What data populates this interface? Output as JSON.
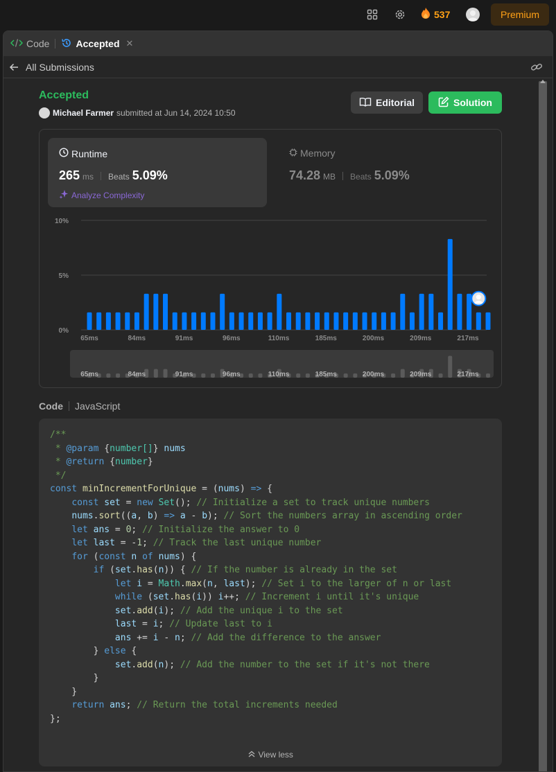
{
  "topbar": {
    "streak_count": "537",
    "premium_label": "Premium",
    "icons": [
      "layout-icon",
      "gear-icon",
      "fire-icon",
      "avatar"
    ]
  },
  "tabs": [
    {
      "label": "Code",
      "icon": "code-icon"
    },
    {
      "label": "Accepted",
      "icon": "history-icon",
      "close": "✕"
    }
  ],
  "subbar": {
    "back_label": "All Submissions"
  },
  "submission": {
    "status": "Accepted",
    "user": "Michael Farmer",
    "submitted_text": "submitted at Jun 14, 2024 10:50",
    "editorial_label": "Editorial",
    "solution_label": "Solution"
  },
  "runtime": {
    "label": "Runtime",
    "value": "265",
    "unit": "ms",
    "beats_label": "Beats",
    "beats_value": "5.09%",
    "analyze_label": "Analyze Complexity"
  },
  "memory": {
    "label": "Memory",
    "value": "74.28",
    "unit": "MB",
    "beats_label": "Beats",
    "beats_value": "5.09%"
  },
  "chart_data": {
    "type": "bar",
    "y_ticks": [
      "10%",
      "5%",
      "0%"
    ],
    "ylim": [
      0,
      10
    ],
    "x_tick_labels": [
      "65ms",
      "84ms",
      "91ms",
      "96ms",
      "110ms",
      "185ms",
      "200ms",
      "209ms",
      "217ms"
    ],
    "values": [
      1.6,
      1.6,
      1.6,
      1.6,
      1.6,
      1.6,
      3.3,
      3.3,
      3.3,
      1.6,
      1.6,
      1.6,
      1.6,
      1.6,
      3.3,
      1.6,
      1.6,
      1.6,
      1.6,
      1.6,
      3.3,
      1.6,
      1.6,
      1.6,
      1.6,
      1.6,
      1.6,
      1.6,
      1.6,
      1.6,
      1.6,
      1.6,
      1.6,
      3.3,
      1.6,
      3.3,
      3.3,
      1.6,
      8.3,
      3.3,
      3.3,
      1.6,
      1.6
    ],
    "highlight_index": 41,
    "bar_color": "#007aff",
    "grid": true
  },
  "code_section": {
    "label": "Code",
    "language": "JavaScript",
    "view_less": "View less",
    "lines": [
      [
        [
          "c",
          "/**"
        ]
      ],
      [
        [
          "c",
          " * "
        ],
        [
          "doc",
          "@param"
        ],
        [
          "c",
          " "
        ],
        [
          "p",
          "{"
        ],
        [
          "t",
          "number[]"
        ],
        [
          "p",
          "}"
        ],
        [
          "v",
          " nums"
        ]
      ],
      [
        [
          "c",
          " * "
        ],
        [
          "doc",
          "@return"
        ],
        [
          "c",
          " "
        ],
        [
          "p",
          "{"
        ],
        [
          "t",
          "number"
        ],
        [
          "p",
          "}"
        ]
      ],
      [
        [
          "c",
          " */"
        ]
      ],
      [
        [
          "k",
          "const"
        ],
        [
          "p",
          " "
        ],
        [
          "f",
          "minIncrementForUnique"
        ],
        [
          "p",
          " = ("
        ],
        [
          "v",
          "nums"
        ],
        [
          "p",
          ") "
        ],
        [
          "k",
          "=>"
        ],
        [
          "p",
          " {"
        ]
      ],
      [
        [
          "p",
          "    "
        ],
        [
          "k",
          "const"
        ],
        [
          "p",
          " "
        ],
        [
          "v",
          "set"
        ],
        [
          "p",
          " = "
        ],
        [
          "k",
          "new"
        ],
        [
          "p",
          " "
        ],
        [
          "t",
          "Set"
        ],
        [
          "p",
          "(); "
        ],
        [
          "c",
          "// Initialize a set to track unique numbers"
        ]
      ],
      [
        [
          "p",
          "    "
        ],
        [
          "v",
          "nums"
        ],
        [
          "p",
          "."
        ],
        [
          "f",
          "sort"
        ],
        [
          "p",
          "(("
        ],
        [
          "v",
          "a"
        ],
        [
          "p",
          ", "
        ],
        [
          "v",
          "b"
        ],
        [
          "p",
          ") "
        ],
        [
          "k",
          "=>"
        ],
        [
          "p",
          " "
        ],
        [
          "v",
          "a"
        ],
        [
          "p",
          " - "
        ],
        [
          "v",
          "b"
        ],
        [
          "p",
          "); "
        ],
        [
          "c",
          "// Sort the numbers array in ascending order"
        ]
      ],
      [
        [
          "p",
          "    "
        ],
        [
          "k",
          "let"
        ],
        [
          "p",
          " "
        ],
        [
          "v",
          "ans"
        ],
        [
          "p",
          " = "
        ],
        [
          "n",
          "0"
        ],
        [
          "p",
          "; "
        ],
        [
          "c",
          "// Initialize the answer to 0"
        ]
      ],
      [
        [
          "p",
          "    "
        ],
        [
          "k",
          "let"
        ],
        [
          "p",
          " "
        ],
        [
          "v",
          "last"
        ],
        [
          "p",
          " = -"
        ],
        [
          "n",
          "1"
        ],
        [
          "p",
          "; "
        ],
        [
          "c",
          "// Track the last unique number"
        ]
      ],
      [
        [
          "p",
          "    "
        ],
        [
          "k",
          "for"
        ],
        [
          "p",
          " ("
        ],
        [
          "k",
          "const"
        ],
        [
          "p",
          " "
        ],
        [
          "v",
          "n"
        ],
        [
          "p",
          " "
        ],
        [
          "k",
          "of"
        ],
        [
          "p",
          " "
        ],
        [
          "v",
          "nums"
        ],
        [
          "p",
          ") {"
        ]
      ],
      [
        [
          "p",
          "        "
        ],
        [
          "k",
          "if"
        ],
        [
          "p",
          " ("
        ],
        [
          "v",
          "set"
        ],
        [
          "p",
          "."
        ],
        [
          "f",
          "has"
        ],
        [
          "p",
          "("
        ],
        [
          "v",
          "n"
        ],
        [
          "p",
          ")) { "
        ],
        [
          "c",
          "// If the number is already in the set"
        ]
      ],
      [
        [
          "p",
          "            "
        ],
        [
          "k",
          "let"
        ],
        [
          "p",
          " "
        ],
        [
          "v",
          "i"
        ],
        [
          "p",
          " = "
        ],
        [
          "t",
          "Math"
        ],
        [
          "p",
          "."
        ],
        [
          "f",
          "max"
        ],
        [
          "p",
          "("
        ],
        [
          "v",
          "n"
        ],
        [
          "p",
          ", "
        ],
        [
          "v",
          "last"
        ],
        [
          "p",
          "); "
        ],
        [
          "c",
          "// Set i to the larger of n or last"
        ]
      ],
      [
        [
          "p",
          "            "
        ],
        [
          "k",
          "while"
        ],
        [
          "p",
          " ("
        ],
        [
          "v",
          "set"
        ],
        [
          "p",
          "."
        ],
        [
          "f",
          "has"
        ],
        [
          "p",
          "("
        ],
        [
          "v",
          "i"
        ],
        [
          "p",
          ")) "
        ],
        [
          "v",
          "i"
        ],
        [
          "p",
          "++; "
        ],
        [
          "c",
          "// Increment i until it's unique"
        ]
      ],
      [
        [
          "p",
          "            "
        ],
        [
          "v",
          "set"
        ],
        [
          "p",
          "."
        ],
        [
          "f",
          "add"
        ],
        [
          "p",
          "("
        ],
        [
          "v",
          "i"
        ],
        [
          "p",
          "); "
        ],
        [
          "c",
          "// Add the unique i to the set"
        ]
      ],
      [
        [
          "p",
          "            "
        ],
        [
          "v",
          "last"
        ],
        [
          "p",
          " = "
        ],
        [
          "v",
          "i"
        ],
        [
          "p",
          "; "
        ],
        [
          "c",
          "// Update last to i"
        ]
      ],
      [
        [
          "p",
          "            "
        ],
        [
          "v",
          "ans"
        ],
        [
          "p",
          " += "
        ],
        [
          "v",
          "i"
        ],
        [
          "p",
          " - "
        ],
        [
          "v",
          "n"
        ],
        [
          "p",
          "; "
        ],
        [
          "c",
          "// Add the difference to the answer"
        ]
      ],
      [
        [
          "p",
          "        } "
        ],
        [
          "k",
          "else"
        ],
        [
          "p",
          " {"
        ]
      ],
      [
        [
          "p",
          "            "
        ],
        [
          "v",
          "set"
        ],
        [
          "p",
          "."
        ],
        [
          "f",
          "add"
        ],
        [
          "p",
          "("
        ],
        [
          "v",
          "n"
        ],
        [
          "p",
          "); "
        ],
        [
          "c",
          "// Add the number to the set if it's not there"
        ]
      ],
      [
        [
          "p",
          "        }"
        ]
      ],
      [
        [
          "p",
          "    }"
        ]
      ],
      [
        [
          "p",
          "    "
        ],
        [
          "k",
          "return"
        ],
        [
          "p",
          " "
        ],
        [
          "v",
          "ans"
        ],
        [
          "p",
          "; "
        ],
        [
          "c",
          "// Return the total increments needed"
        ]
      ],
      [
        [
          "p",
          "};"
        ]
      ]
    ]
  }
}
